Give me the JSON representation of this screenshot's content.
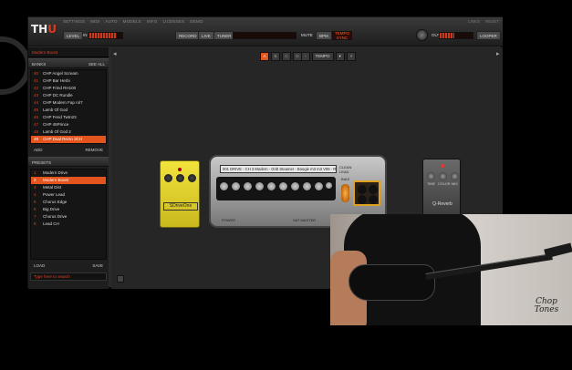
{
  "app": {
    "logo_prefix": "TH",
    "logo_suffix": "U",
    "menu": [
      "SETTINGS",
      "MIDI",
      "AUTO",
      "MODELS",
      "INFO",
      "LICENSES",
      "DEMO"
    ],
    "menu_right": [
      "LINKS",
      "RESET"
    ],
    "toolbar": {
      "level_label": "LEVEL",
      "in_label": "IN",
      "record_label": "RECORD",
      "live_label": "LIVE",
      "tuner_label": "TUNER",
      "mute_label": "MUTE",
      "bpm_label": "BPM",
      "tempo_line1": "TEMPO",
      "tempo_line2": "SYNC",
      "out_label": "OUT",
      "looper_label": "LOOPER",
      "in_level": 0.82,
      "out_level": 0.45
    }
  },
  "banks": {
    "folder": "Modern Boost",
    "header": "BANKS",
    "header_right": "SEE ALL",
    "items": [
      {
        "num": "40",
        "name": "CHP Angel Scream"
      },
      {
        "num": "41",
        "name": "CHP Bar Herbi"
      },
      {
        "num": "42",
        "name": "CHP Frind RH100"
      },
      {
        "num": "43",
        "name": "CHP DC Rundle"
      },
      {
        "num": "44",
        "name": "CHP Modern Fap rol7"
      },
      {
        "num": "45",
        "name": "Lamb Of God"
      },
      {
        "num": "46",
        "name": "CHP Fend TwIn23"
      },
      {
        "num": "47",
        "name": "CHP 45Prince"
      },
      {
        "num": "48",
        "name": "Lamb Of God 2"
      },
      {
        "num": "49",
        "name": "CHP Dual Recto 3CH"
      }
    ],
    "selected_index": 9,
    "add_label": "ADD",
    "remove_label": "REMOVE"
  },
  "presets": {
    "header": "PRESETS",
    "items": [
      {
        "num": "1",
        "name": "Modern Drive"
      },
      {
        "num": "2",
        "name": "Modern Boost"
      },
      {
        "num": "3",
        "name": "Metal Dist"
      },
      {
        "num": "4",
        "name": "Power Lead"
      },
      {
        "num": "5",
        "name": "Chorus Edge"
      },
      {
        "num": "6",
        "name": "Big Drive"
      },
      {
        "num": "7",
        "name": "Chorus Drive"
      },
      {
        "num": "8",
        "name": "Lead CH"
      }
    ],
    "selected_index": 1,
    "load_label": "LOAD",
    "save_label": "SAVE",
    "search_placeholder": "Type here to search"
  },
  "main": {
    "slots": [
      "A",
      "B",
      "C",
      "D"
    ],
    "active_slot": 0,
    "tempo_minus": "-",
    "tempo_value": "TEMPO",
    "tempo_dropdown": "▾",
    "tempo_plus": "+"
  },
  "rig": {
    "drive_pedal_name": "SDriveOne",
    "amp_lcd": "001 DRIVE - CH 3 Modern - Gritt Steamer - Boogie m3 m3 V08 - RH13",
    "amp_sw_line1": "CLEAN",
    "amp_sw_line2": "LEAD",
    "amp_bright": "BRIGHT",
    "amp_power": "POWER",
    "amp_bias": "BIAS",
    "amp_sat_label": "SAT MASTER",
    "amp_vol_label": "VOL",
    "reverb_pedal_name": "Q-Reverb",
    "reverb_knobs": [
      "TIME",
      "COLOR",
      "MIX"
    ]
  },
  "overlay": {
    "brand_line1": "Chop",
    "brand_line2": "Tones"
  }
}
